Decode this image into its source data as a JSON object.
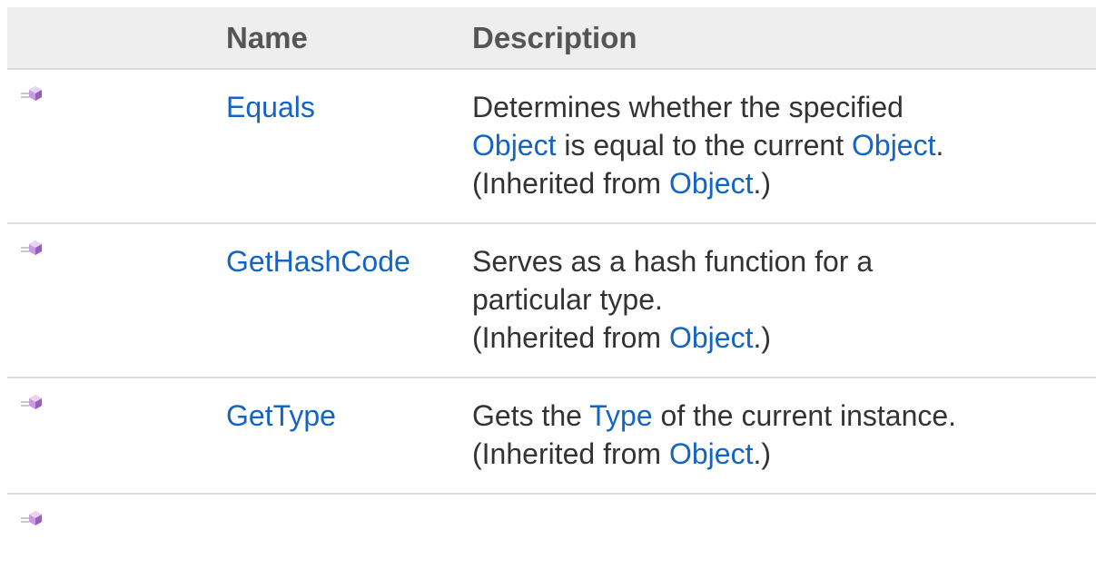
{
  "table": {
    "headers": {
      "icon": "",
      "name": "Name",
      "description": "Description"
    },
    "rows": [
      {
        "icon": "public-method-icon",
        "name": "Equals",
        "desc": {
          "l1": "Determines whether the specified",
          "l2a": "Object",
          "l2b": " is equal to the current ",
          "l2c": "Object",
          "l2d": ".",
          "inh_pre": "(Inherited from ",
          "inh_link": "Object",
          "inh_post": ".)"
        }
      },
      {
        "icon": "public-method-icon",
        "name": "GetHashCode",
        "desc": {
          "l1": "Serves as a hash function for a",
          "l2": "particular type.",
          "inh_pre": "(Inherited from ",
          "inh_link": "Object",
          "inh_post": ".)"
        }
      },
      {
        "icon": "public-method-icon",
        "name": "GetType",
        "desc": {
          "l1a": "Gets the ",
          "l1b": "Type",
          "l1c": " of the current instance.",
          "inh_pre": "(Inherited from ",
          "inh_link": "Object",
          "inh_post": ".)"
        }
      },
      {
        "icon": "public-method-icon"
      }
    ]
  },
  "colors": {
    "link": "#1364c4",
    "header_bg": "#eeeeee",
    "border": "#dddddd",
    "icon_purple": "#b57fd6"
  }
}
